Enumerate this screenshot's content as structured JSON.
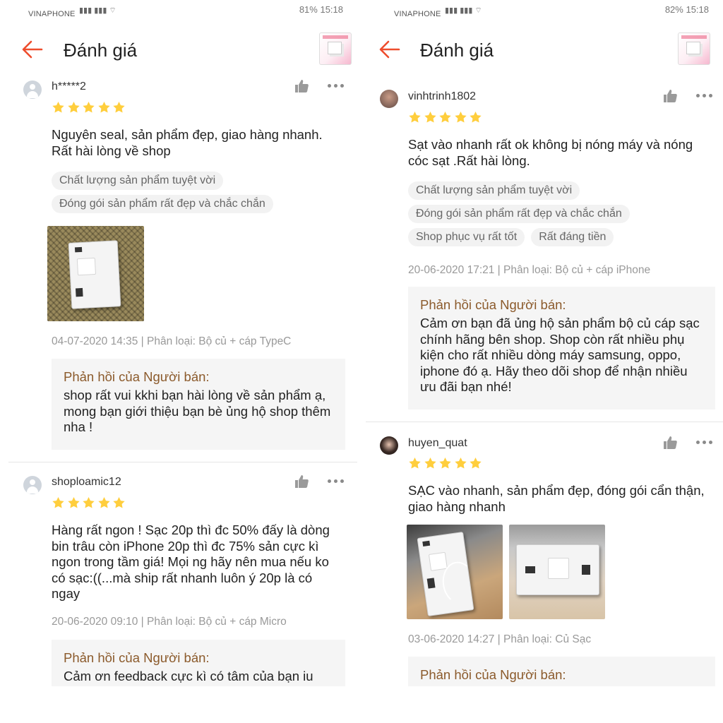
{
  "left": {
    "status": {
      "carrier": "VINAPHONE",
      "right": "81% 15:18"
    },
    "header": {
      "title": "Đánh giá"
    },
    "reviews": [
      {
        "username": "h*****2",
        "comment": "Nguyên seal, sản phẩm đẹp, giao hàng nhanh. Rất hài lòng về shop",
        "tags": [
          "Chất lượng sản phẩm tuyệt vời",
          "Đóng gói sản phẩm rất đẹp và chắc chắn"
        ],
        "meta": "04-07-2020 14:35 | Phân loại: Bộ củ + cáp TypeC",
        "reply_title": "Phản hồi của Người bán:",
        "reply_text": "shop rất vui kkhi bạn hài lòng về sản phẩm ạ, mong bạn giới thiệu bạn bè ủng hộ shop thêm nha !"
      },
      {
        "username": "shoploamic12",
        "comment": "Hàng rất ngon ! Sạc 20p thì đc 50% đấy là dòng bin trâu còn iPhone 20p thì đc 75% sản cực kì ngon trong tầm giá! Mọi ng hãy nên mua nếu ko có sạc:((...mà ship rất nhanh luôn ý 20p là có ngay",
        "meta": "20-06-2020 09:10 | Phân loại: Bộ củ + cáp Micro",
        "reply_title": "Phản hồi của Người bán:",
        "reply_text": "Cảm ơn feedback cực kì có tâm của bạn iu"
      }
    ]
  },
  "right": {
    "status": {
      "carrier": "VINAPHONE",
      "right": "82% 15:18"
    },
    "header": {
      "title": "Đánh giá"
    },
    "reviews": [
      {
        "username": "vinhtrinh1802",
        "comment": "Sạt vào nhanh rất ok không bị nóng máy và nóng cóc sạt .Rất hài lòng.",
        "tags": [
          "Chất lượng sản phẩm tuyệt vời",
          "Đóng gói sản phẩm rất đẹp và chắc chắn",
          "Shop phục vụ rất tốt",
          "Rất đáng tiền"
        ],
        "meta": "20-06-2020 17:21 | Phân loại: Bộ củ + cáp iPhone",
        "reply_title": "Phản hồi của Người bán:",
        "reply_text": "Cảm ơn bạn đã ủng hộ sản phẩm bộ củ cáp sạc chính hãng bên shop. Shop còn rất nhiều phụ kiện cho rất nhiều dòng máy samsung, oppo, iphone đó ạ. Hãy theo dõi shop để nhận nhiều ưu đãi bạn nhé!"
      },
      {
        "username": "huyen_quat",
        "comment": "SẠC vào nhanh, sản phẩm đẹp, đóng gói cẩn thận, giao hàng nhanh",
        "meta": "03-06-2020 14:27 | Phân loại: Củ Sạc",
        "reply_title": "Phản hồi của Người bán:"
      }
    ]
  },
  "rating_stars": 5,
  "colors": {
    "accent": "#ee4d2d",
    "star": "#ffce3d",
    "reply_title": "#8b5a2b",
    "tag_bg": "#f2f2f2"
  },
  "icons": {
    "back": "arrow-left-icon",
    "like": "thumbs-up-icon",
    "more": "more-dots-icon",
    "star": "star-icon"
  }
}
